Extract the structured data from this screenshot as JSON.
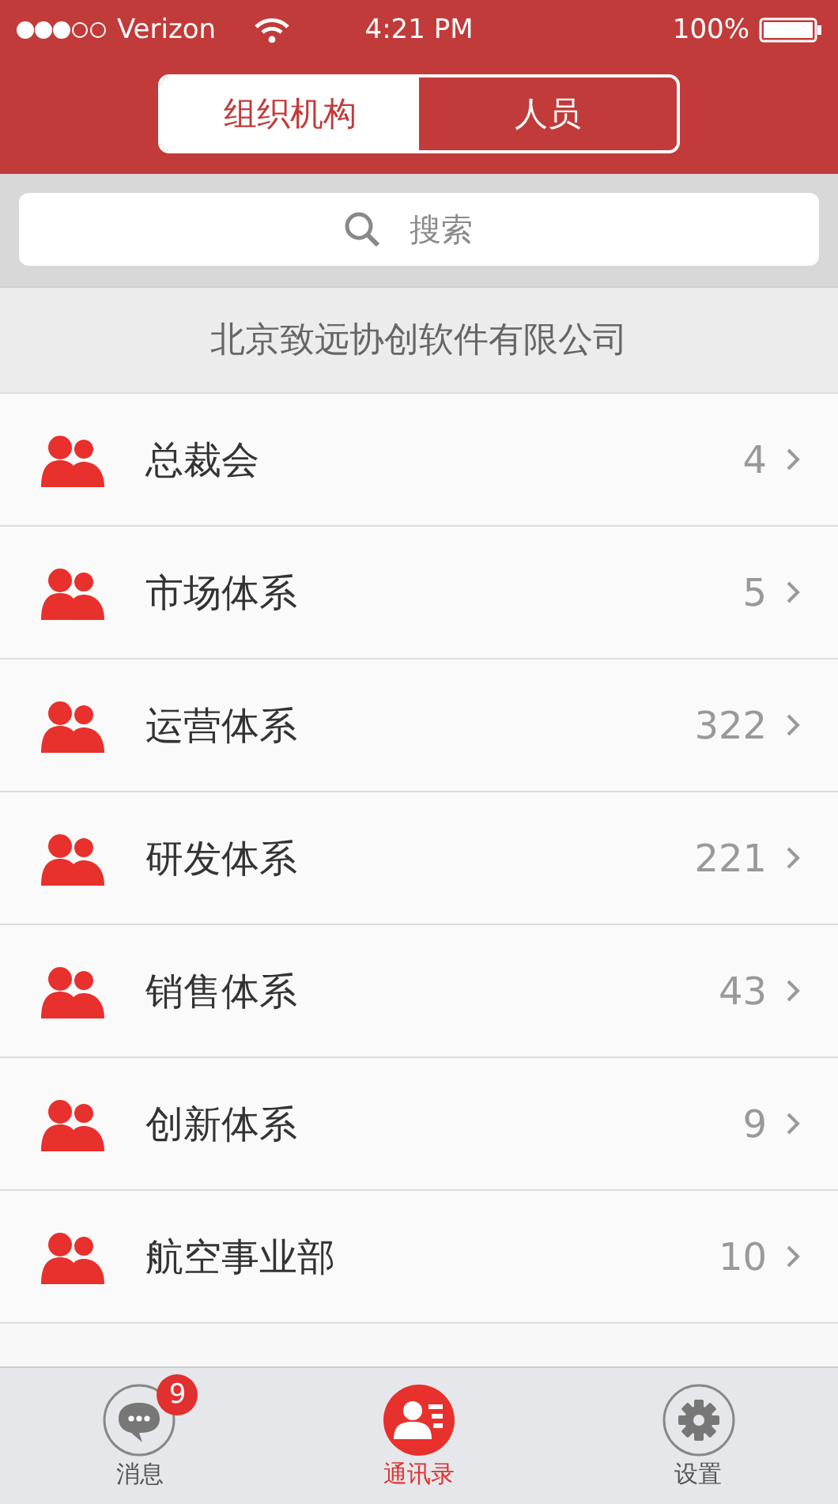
{
  "status_bar": {
    "carrier": "Verizon",
    "time": "4:21 PM",
    "battery": "100%"
  },
  "segments": [
    {
      "label": "组织机构",
      "selected": true
    },
    {
      "label": "人员",
      "selected": false
    }
  ],
  "search": {
    "placeholder": "搜索"
  },
  "company": "北京致远协创软件有限公司",
  "departments": [
    {
      "name": "总裁会",
      "count": "4"
    },
    {
      "name": "市场体系",
      "count": "5"
    },
    {
      "name": "运营体系",
      "count": "322"
    },
    {
      "name": "研发体系",
      "count": "221"
    },
    {
      "name": "销售体系",
      "count": "43"
    },
    {
      "name": "创新体系",
      "count": "9"
    },
    {
      "name": "航空事业部",
      "count": "10"
    }
  ],
  "tab_bar": [
    {
      "kind": "messages",
      "label": "消息",
      "badge": "9",
      "selected": false
    },
    {
      "kind": "contacts",
      "label": "通讯录",
      "selected": true
    },
    {
      "kind": "settings",
      "label": "设置",
      "selected": false
    }
  ]
}
